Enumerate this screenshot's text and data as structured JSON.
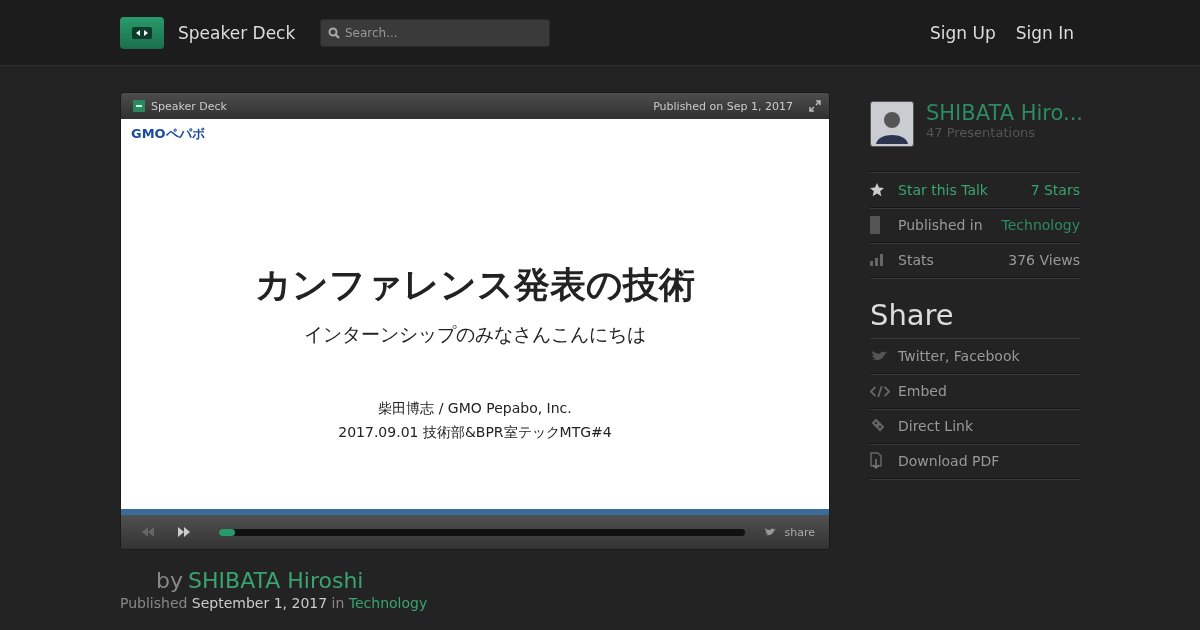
{
  "header": {
    "brand": "Speaker Deck",
    "search": {
      "placeholder": "Search..."
    },
    "nav": [
      "Sign Up",
      "Sign In"
    ]
  },
  "player": {
    "brand": "Speaker Deck",
    "published": "Published on Sep 1, 2017",
    "slide": {
      "logo": "GMOペパボ",
      "title": "カンファレンス発表の技術",
      "subtitle": "インターンシップのみなさんこんにちは",
      "lines": [
        "柴田博志 / GMO Pepabo, Inc.",
        "2017.09.01 技術部&BPR室テックMTG#4"
      ]
    },
    "progress": {
      "level": 0.03
    },
    "share": "share"
  },
  "byline": {
    "by": "by",
    "author": "SHIBATA Hiroshi",
    "published": "Published",
    "date": "September 1, 2017",
    "in": "in",
    "category": "Technology"
  },
  "sidebar": {
    "author": {
      "name": "SHIBATA Hiro...",
      "count": "47 Presentations"
    },
    "stats": [
      {
        "kind": "star",
        "label": "Star this Talk",
        "value": "7 Stars"
      },
      {
        "kind": "category",
        "label": "Published in",
        "value": "Technology"
      },
      {
        "kind": "stats",
        "label": "Stats",
        "value": "376 Views"
      }
    ],
    "share_title": "Share",
    "share": [
      {
        "kind": "bird",
        "label": "Twitter, Facebook"
      },
      {
        "kind": "code",
        "label": "Embed"
      },
      {
        "kind": "link",
        "label": "Direct Link"
      },
      {
        "kind": "pdf",
        "label": "Download PDF"
      }
    ]
  }
}
